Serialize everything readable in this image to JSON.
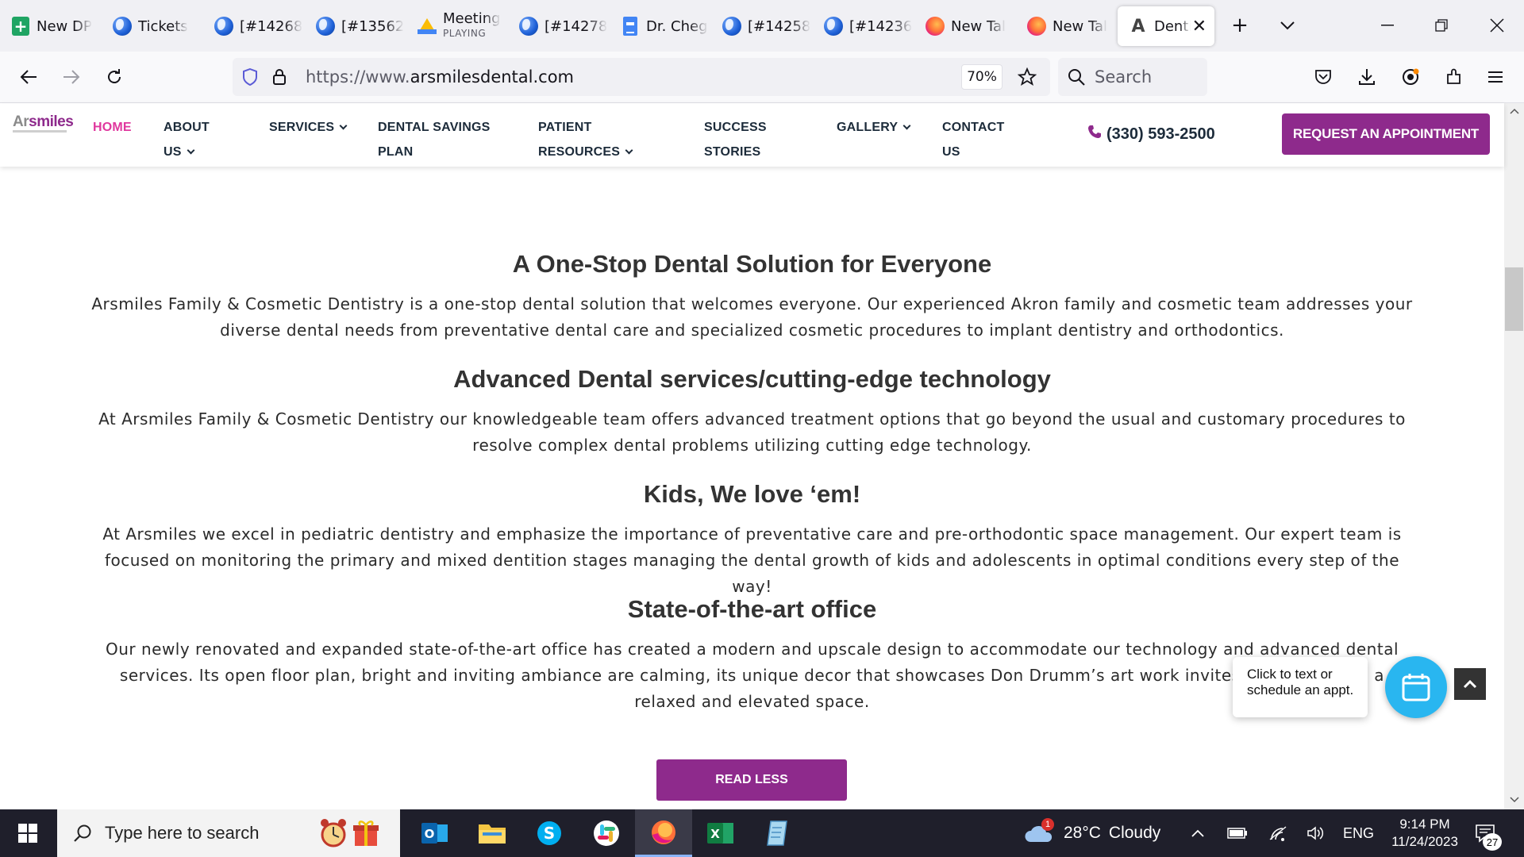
{
  "browser": {
    "tabs": [
      {
        "label": "New DP",
        "icon": "sheets-icon"
      },
      {
        "label": "Tickets",
        "icon": "globe-icon"
      },
      {
        "label": "[#14268",
        "icon": "globe-icon"
      },
      {
        "label": "[#13562",
        "icon": "globe-icon"
      },
      {
        "label": "Meeting",
        "sublabel": "PLAYING",
        "icon": "drive-icon"
      },
      {
        "label": "[#14278",
        "icon": "globe-icon"
      },
      {
        "label": "Dr. Cheg",
        "icon": "docs-icon"
      },
      {
        "label": "[#14258",
        "icon": "globe-icon"
      },
      {
        "label": "[#14236",
        "icon": "globe-icon"
      },
      {
        "label": "New Tal",
        "icon": "firefox-icon"
      },
      {
        "label": "New Tal",
        "icon": "firefox-icon"
      },
      {
        "label": "Denti",
        "icon": "site-icon",
        "active": true
      }
    ],
    "url_prefix": "https://www.",
    "url_host": "arsmilesdental.com",
    "zoom": "70%",
    "search_placeholder": "Search"
  },
  "site": {
    "logo_part1": "Ar",
    "logo_part2": "smiles",
    "menu": {
      "home": "HOME",
      "about_1": "ABOUT",
      "about_2": "US",
      "services": "SERVICES",
      "savings_1": "DENTAL SAVINGS",
      "savings_2": "PLAN",
      "patient_1": "PATIENT",
      "patient_2": "RESOURCES",
      "success_1": "SUCCESS",
      "success_2": "STORIES",
      "gallery": "GALLERY",
      "contact_1": "CONTACT",
      "contact_2": "US"
    },
    "phone": "(330) 593-2500",
    "appointment_button": "REQUEST AN APPOINTMENT"
  },
  "content": {
    "sections": [
      {
        "heading": "A One-Stop Dental Solution for Everyone",
        "body": "Arsmiles Family & Cosmetic Dentistry is a one-stop dental solution that welcomes everyone. Our experienced Akron family and cosmetic team addresses your diverse dental needs from preventative dental care and specialized cosmetic procedures to implant dentistry and orthodontics."
      },
      {
        "heading": "Advanced Dental services/cutting-edge technology",
        "body": "At Arsmiles Family & Cosmetic Dentistry our knowledgeable team offers advanced treatment options that go beyond the usual and customary procedures to resolve complex dental problems utilizing cutting edge technology."
      },
      {
        "heading": "Kids, We love ‘em!",
        "body": "At Arsmiles we excel in pediatric dentistry and emphasize the importance of preventative care and pre-orthodontic space management. Our expert team is focused on monitoring the primary and mixed dentition stages managing the dental growth of kids and adolescents in optimal conditions every step of the way!"
      },
      {
        "heading": "State-of-the-art office",
        "body": "Our newly renovated and expanded state-of-the-art office has created a modern and upscale design to accommodate our technology and advanced dental services. Its open floor plan, bright and inviting ambiance are calming, its unique decor that showcases Don Drumm’s art work invites our patients to a relaxed and elevated space."
      }
    ],
    "read_less": "READ LESS",
    "chat_tip": "Click to text or schedule an appt."
  },
  "taskbar": {
    "search_placeholder": "Type here to search",
    "weather_temp": "28°C",
    "weather_desc": "Cloudy",
    "weather_badge": "1",
    "language": "ENG",
    "time": "9:14 PM",
    "date": "11/24/2023",
    "notification_count": "27"
  }
}
